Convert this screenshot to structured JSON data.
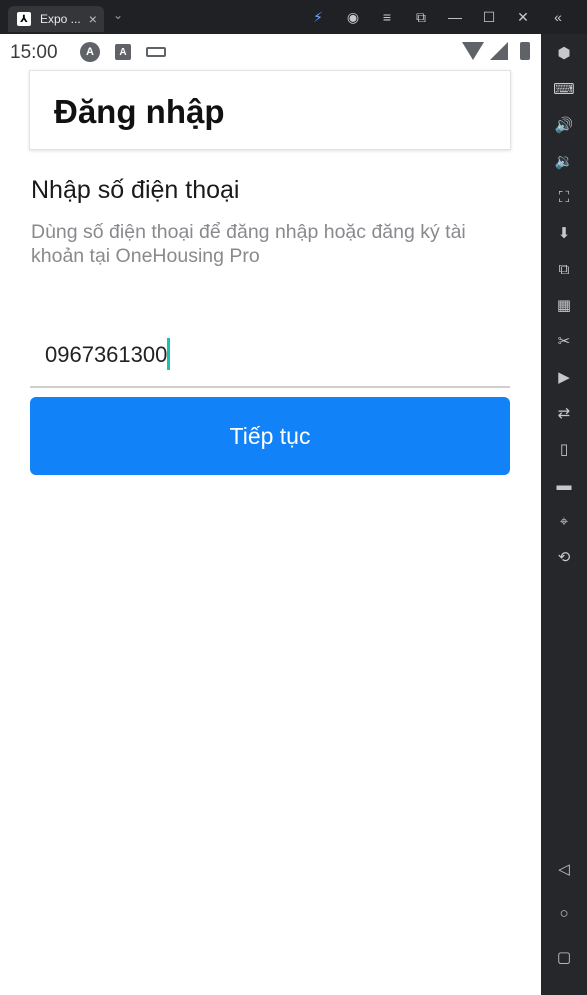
{
  "window": {
    "tab_title": "Expo ...",
    "tab_close": "×",
    "tab_dropdown": "⌄",
    "toolbar_icons": [
      "bolt-icon",
      "account-icon",
      "menu-icon",
      "pip-icon",
      "minimize-icon",
      "maximize-icon",
      "close-icon",
      "collapse-icon"
    ]
  },
  "statusbar": {
    "time": "15:00",
    "icon_a": "A",
    "icon_b": "A"
  },
  "header": {
    "title": "Đăng nhập"
  },
  "form": {
    "section_title": "Nhập số điện thoại",
    "subtitle": "Dùng số điện thoại để đăng nhập hoặc đăng ký tài khoản tại OneHousing Pro",
    "phone_value": "0967361300",
    "submit_label": "Tiếp tục"
  },
  "colors": {
    "button": "#1282f8",
    "caret": "#15c3b0",
    "subtitle_text": "#8a8a8e"
  },
  "sidebar_tools": [
    "settings-icon",
    "keyboard-map-icon",
    "volume-up-icon",
    "volume-down-icon",
    "screenshot-icon",
    "install-icon",
    "multi-window-icon",
    "apk-icon",
    "cut-icon",
    "record-icon",
    "sync-icon",
    "shake-icon",
    "folder-icon",
    "location-icon",
    "rotate-icon",
    "back-icon",
    "home-icon",
    "recents-icon"
  ]
}
